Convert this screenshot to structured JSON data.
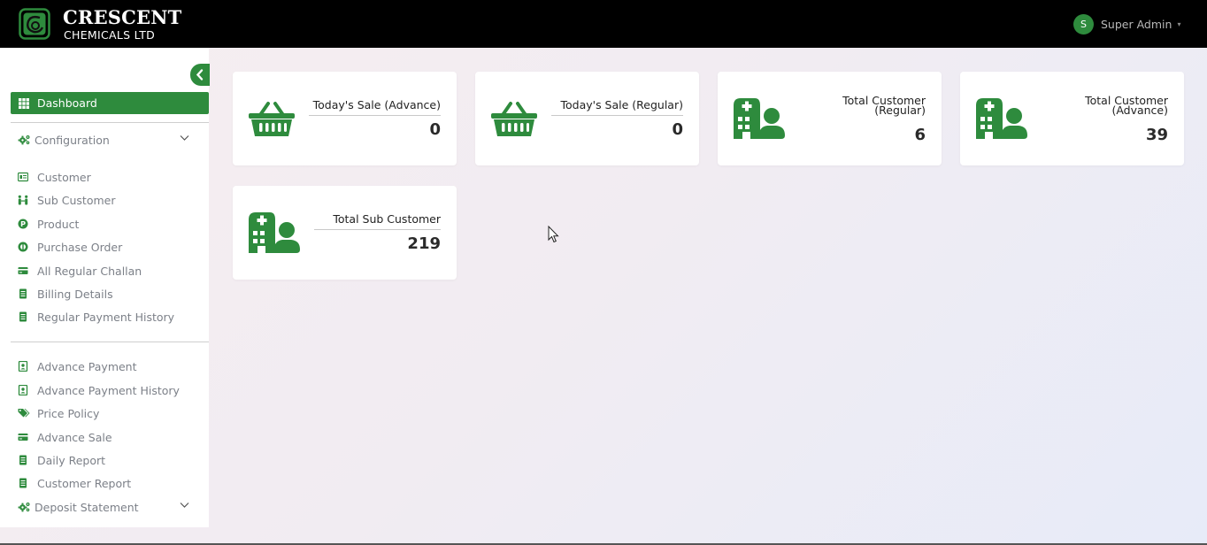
{
  "header": {
    "brand_line1": "CRESCENT",
    "brand_line2": "CHEMICALS LTD",
    "user_initial": "S",
    "user_name": "Super Admin"
  },
  "sidebar": {
    "active": "Dashboard",
    "configuration_label": "Configuration",
    "items_group1": [
      {
        "label": "Customer",
        "icon": "id-card-icon"
      },
      {
        "label": "Sub Customer",
        "icon": "users-link-icon"
      },
      {
        "label": "Product",
        "icon": "product-p-icon"
      },
      {
        "label": "Purchase Order",
        "icon": "purchase-order-icon"
      },
      {
        "label": "All Regular Challan",
        "icon": "credit-card-icon"
      },
      {
        "label": "Billing Details",
        "icon": "document-icon"
      },
      {
        "label": "Regular Payment History",
        "icon": "document-icon"
      }
    ],
    "items_group2": [
      {
        "label": "Advance Payment",
        "icon": "contact-book-icon"
      },
      {
        "label": "Advance Payment History",
        "icon": "contact-book-icon"
      },
      {
        "label": "Price Policy",
        "icon": "tags-icon"
      },
      {
        "label": "Advance Sale",
        "icon": "credit-card-icon"
      },
      {
        "label": "Daily Report",
        "icon": "document-icon"
      },
      {
        "label": "Customer Report",
        "icon": "document-icon"
      }
    ],
    "deposit_label": "Deposit Statement"
  },
  "cards": [
    {
      "label": "Today's Sale (Advance)",
      "value": "0",
      "icon": "basket-icon"
    },
    {
      "label": "Today's Sale (Regular)",
      "value": "0",
      "icon": "basket-icon"
    },
    {
      "label_line1": "Total Customer",
      "label_line2": "(Regular)",
      "value": "6",
      "icon": "hospital-user-icon"
    },
    {
      "label_line1": "Total Customer",
      "label_line2": "(Advance)",
      "value": "39",
      "icon": "hospital-user-icon"
    },
    {
      "label": "Total Sub Customer",
      "value": "219",
      "icon": "hospital-user-icon"
    }
  ],
  "colors": {
    "brand_green": "#2e8b3d",
    "topbar": "#000000",
    "sidebar_text": "#7c8088"
  }
}
